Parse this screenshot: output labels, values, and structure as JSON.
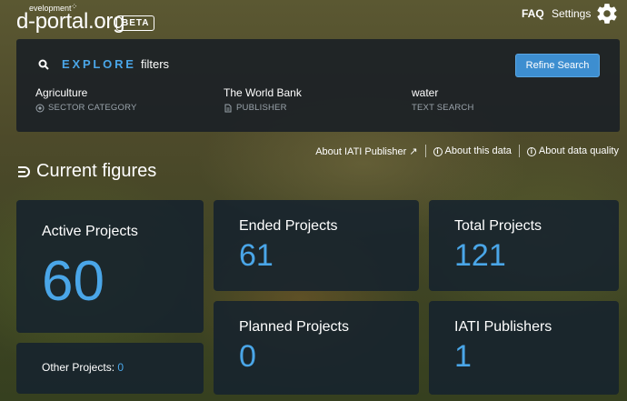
{
  "header": {
    "logo_small": "evelopment",
    "logo_main": "d-portal.org",
    "beta": "BETA",
    "faq": "FAQ",
    "settings": "Settings"
  },
  "explore": {
    "title": "EXPLORE",
    "subtitle": "filters",
    "refine_button": "Refine Search",
    "filters": [
      {
        "value": "Agriculture",
        "type": "SECTOR CATEGORY",
        "icon": "target-icon"
      },
      {
        "value": "The World Bank",
        "type": "PUBLISHER",
        "icon": "document-icon"
      },
      {
        "value": "water",
        "type": "TEXT SEARCH",
        "icon": ""
      }
    ]
  },
  "links": {
    "publisher": "About IATI Publisher ↗",
    "data": "About this data",
    "quality": "About data quality"
  },
  "figures": {
    "title": "Current figures",
    "active": {
      "label": "Active Projects",
      "value": "60"
    },
    "other": {
      "label": "Other Projects:",
      "value": "0"
    },
    "ended": {
      "label": "Ended Projects",
      "value": "61"
    },
    "planned": {
      "label": "Planned Projects",
      "value": "0"
    },
    "total": {
      "label": "Total Projects",
      "value": "121"
    },
    "publishers": {
      "label": "IATI Publishers",
      "value": "1"
    }
  },
  "colors": {
    "accent": "#4aa6e8",
    "button": "#3d8ed0",
    "panel": "#1c2126"
  }
}
